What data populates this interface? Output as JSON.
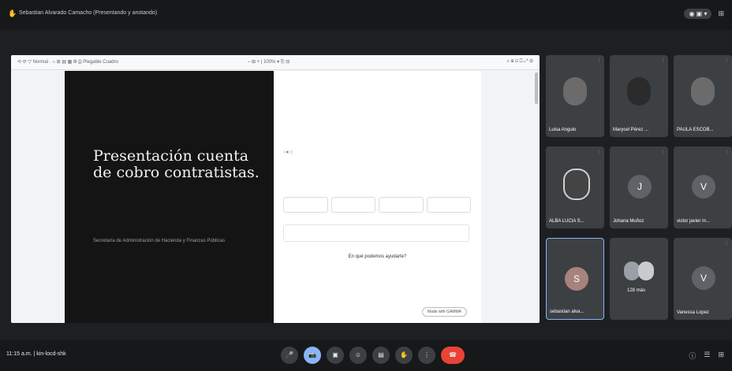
{
  "topbar": {
    "presenter_text": "Sebastian Alvarado Camacho (Presentando y anotando)",
    "hand_icon": "hand-icon",
    "pill_label": "◉ ▣ ▾",
    "grid_icon": "grid-icon"
  },
  "presentation": {
    "toolbar_left": "⟲ ⟳   ▽ Normal  ·  ⌂  ⊞  ▤  ▦ Ⅲ   ⎙ Plegable Cuadro",
    "toolbar_mid": "– ⊞ +  |  100%  ▾   ⎘ ⊟",
    "toolbar_right": "⌕  ⊞  ⊡  ◫  ⤢  ⚙",
    "slide_title": "Presentación cuenta de cobro contratistas.",
    "slide_subtitle": "Secretaría de Administración de Hacienda y Finanzas Públicas",
    "form_header": "1  ▣ ◫",
    "help_text": "En qué podemos ayudarte?",
    "made_with": "Made with GAMMA"
  },
  "participants": [
    {
      "name": "Luisa Angulo",
      "type": "photo"
    },
    {
      "name": "Marycel Pérez ...",
      "type": "photo"
    },
    {
      "name": "PAULA ESCOB...",
      "type": "photo"
    },
    {
      "name": "ALBA LUCIA S...",
      "type": "photo"
    },
    {
      "name": "Johana Muñoz",
      "type": "initial",
      "initial": "J"
    },
    {
      "name": "victor javier m...",
      "type": "initial",
      "initial": "V"
    },
    {
      "name": "sebastian alva...",
      "type": "initial",
      "initial": "S"
    },
    {
      "name": "128 más",
      "type": "more"
    },
    {
      "name": "Vanessa Lopez",
      "type": "initial",
      "initial": "V"
    }
  ],
  "bottombar": {
    "time_meeting": "11:15 a.m.  |  kin-locd-shk",
    "controls": [
      "🎤",
      "📷",
      "▣",
      "☺",
      "▤",
      "✋",
      "⋮",
      "☎"
    ],
    "right_icons": [
      "ⓘ",
      "☰",
      "⊞"
    ]
  },
  "colors": {
    "background": "#1e1f22",
    "tile": "#3c4043",
    "active_control": "#8ab4f8",
    "end_call": "#ea4335"
  }
}
